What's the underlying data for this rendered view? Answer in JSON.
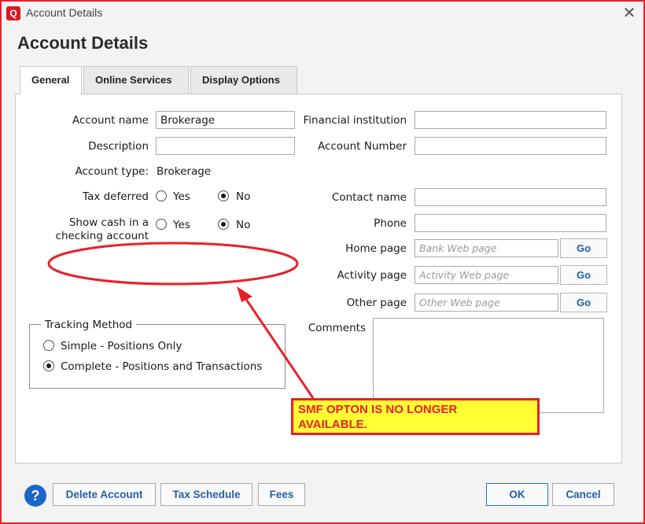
{
  "window": {
    "title": "Account Details",
    "app_icon": "quicken-icon",
    "close_glyph": "✕"
  },
  "heading": "Account Details",
  "tabs": [
    {
      "label": "General",
      "active": true
    },
    {
      "label": "Online Services",
      "active": false
    },
    {
      "label": "Display Options",
      "active": false
    }
  ],
  "left": {
    "account_name_label": "Account name",
    "account_name_value": "Brokerage",
    "description_label": "Description",
    "description_value": "",
    "account_type_label": "Account type:",
    "account_type_value": "Brokerage",
    "tax_deferred_label": "Tax deferred",
    "show_cash_label_1": "Show cash in a",
    "show_cash_label_2": "checking account",
    "yes": "Yes",
    "no": "No",
    "tax_deferred_selected": "No",
    "show_cash_selected": "No"
  },
  "tracking": {
    "legend": "Tracking Method",
    "options": [
      "Simple - Positions Only",
      "Complete - Positions and Transactions"
    ],
    "selected": "Complete - Positions and Transactions"
  },
  "right": {
    "financial_institution_label": "Financial institution",
    "account_number_label": "Account Number",
    "contact_name_label": "Contact name",
    "phone_label": "Phone",
    "home_page_label": "Home page",
    "home_page_placeholder": "Bank Web page",
    "activity_page_label": "Activity page",
    "activity_page_placeholder": "Activity Web page",
    "other_page_label": "Other page",
    "other_page_placeholder": "Other Web page",
    "go": "Go",
    "comments_label": "Comments"
  },
  "buttons": {
    "help": "?",
    "delete": "Delete Account",
    "tax_schedule": "Tax Schedule",
    "fees": "Fees",
    "ok": "OK",
    "cancel": "Cancel"
  },
  "annotation": {
    "note_line1": "SMF OPTON IS NO LONGER",
    "note_line2": "AVAILABLE.",
    "color": "#e8202a"
  },
  "colors": {
    "accent": "#1f5fa8",
    "help": "#1d66c9",
    "annotation": "#e8202a",
    "note_bg": "#ffff33"
  }
}
